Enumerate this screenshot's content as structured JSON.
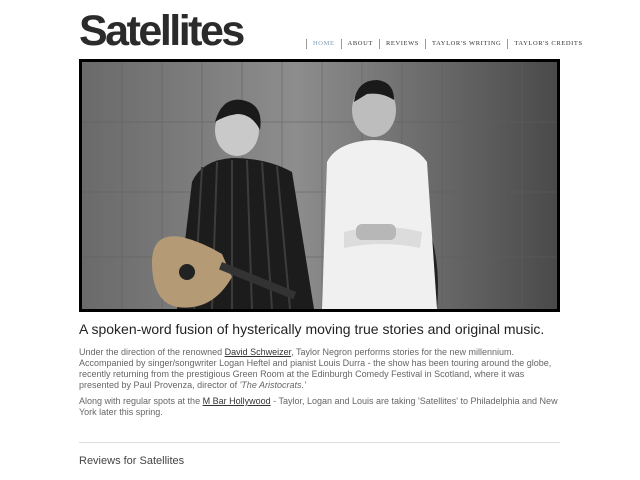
{
  "site": {
    "logo": "Satellites"
  },
  "nav": {
    "home": "Home",
    "about": "About",
    "reviews": "Reviews",
    "writing": "Taylor's Writing",
    "credits": "Taylor's Credits"
  },
  "hero": {
    "image_description": "Black and white photo of two performers, one holding an acoustic guitar"
  },
  "main": {
    "tagline": "A spoken-word fusion of hysterically moving true stories and original music.",
    "p1_a": "Under the direction of the renowned ",
    "p1_link": "David Schweizer",
    "p1_b": ", Taylor Negron performs stories for the new millennium. Accompanied by singer/songwriter Logan Heftel and pianist Louis Durra - the show has been touring around the globe, recently returning from the prestigious Green Room at the Edinburgh Comedy Festival in Scotland, where it was presented by Paul Provenza, director of ",
    "p1_italic": "'The Aristocrats.'",
    "p2_a": "Along with regular spots at the ",
    "p2_link": "M Bar Hollywood",
    "p2_b": " - Taylor, Logan and Louis are taking 'Satellites' to Philadelphia and New York later this spring.",
    "reviews_heading": "Reviews for Satellites"
  },
  "colors": {
    "nav_active": "#7a9bb0",
    "logo": "#2b2b2b"
  }
}
